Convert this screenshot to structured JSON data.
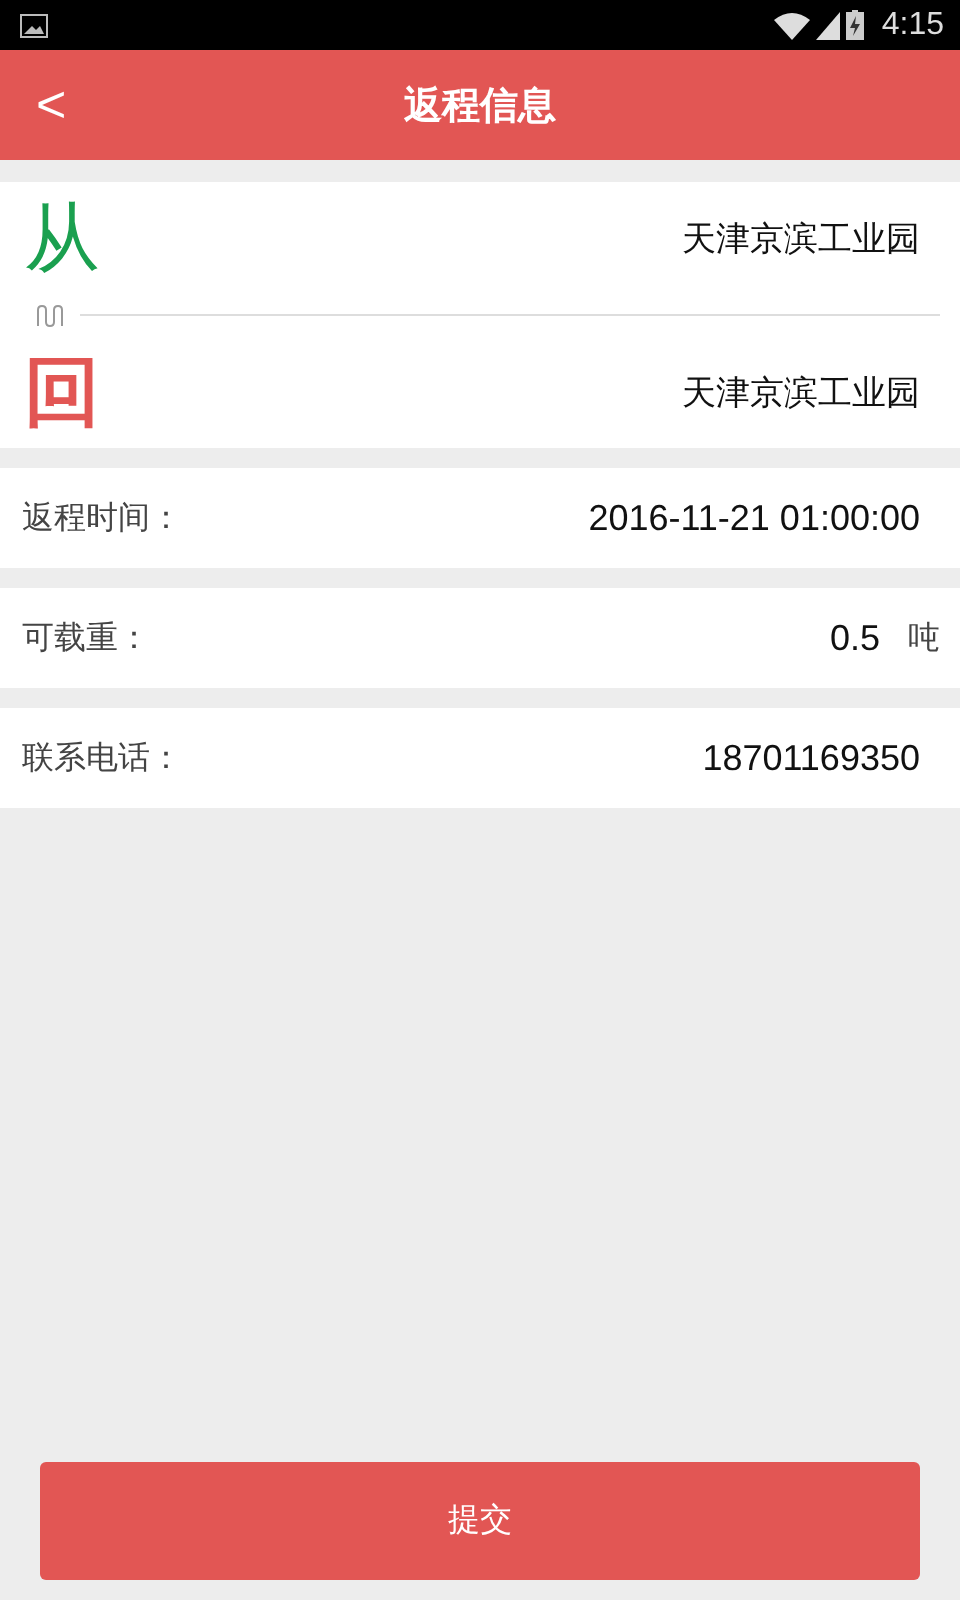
{
  "status_bar": {
    "time": "4:15"
  },
  "header": {
    "back": "<",
    "title": "返程信息"
  },
  "route": {
    "from": {
      "mark": "从",
      "place": "天津京滨工业园"
    },
    "to": {
      "mark": "回",
      "place": "天津京滨工业园"
    }
  },
  "fields": [
    {
      "label": "返程时间：",
      "value": "2016-11-21 01:00:00"
    },
    {
      "label": "可载重：",
      "value": "0.5",
      "unit": "吨"
    },
    {
      "label": "联系电话：",
      "value": "18701169350"
    }
  ],
  "submit": "提交"
}
